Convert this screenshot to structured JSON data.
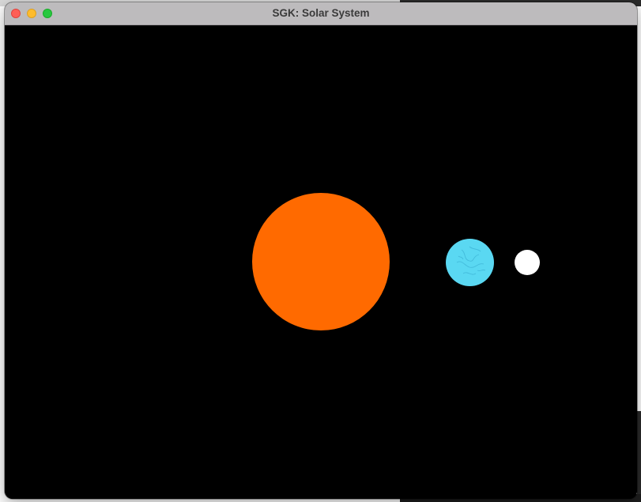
{
  "window": {
    "title": "SGK: Solar System"
  },
  "scene": {
    "background_color": "#000000",
    "bodies": [
      {
        "name": "sun",
        "color": "#ff6a00"
      },
      {
        "name": "earth",
        "color": "#5ad8f2"
      },
      {
        "name": "moon",
        "color": "#ffffff"
      }
    ]
  },
  "icons": {
    "close": "close-icon",
    "minimize": "minimize-icon",
    "maximize": "maximize-icon"
  }
}
